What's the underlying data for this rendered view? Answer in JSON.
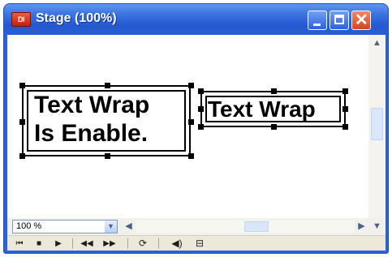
{
  "window": {
    "title": "Stage (100%)",
    "app_icon_text": "Dl",
    "buttons": [
      "minimize",
      "maximize",
      "close"
    ]
  },
  "stage": {
    "textboxes": [
      {
        "text_line1": "Text Wrap",
        "text_line2": "Is Enable.",
        "wrap": true
      },
      {
        "text_line1": "Text Wrap",
        "wrap": false
      }
    ]
  },
  "zoom": {
    "value": "100 %"
  },
  "icons": {
    "app": "director-icon",
    "minimize": "minimize-icon",
    "maximize": "maximize-icon",
    "close": "close-icon",
    "scroll_up": "chevron-up-icon",
    "scroll_down": "chevron-down-icon",
    "scroll_left": "chevron-left-icon",
    "scroll_right": "chevron-right-icon",
    "rewind": "rewind-icon",
    "stop": "stop-icon",
    "play": "play-icon",
    "step_back": "step-back-icon",
    "step_forward": "step-forward-icon",
    "loop": "loop-icon",
    "volume": "volume-icon",
    "frame_counter": "frame-counter-icon"
  },
  "colors": {
    "titlebar": "#2458d0",
    "close_button": "#d4451f",
    "stage_background": "#ffffff"
  }
}
